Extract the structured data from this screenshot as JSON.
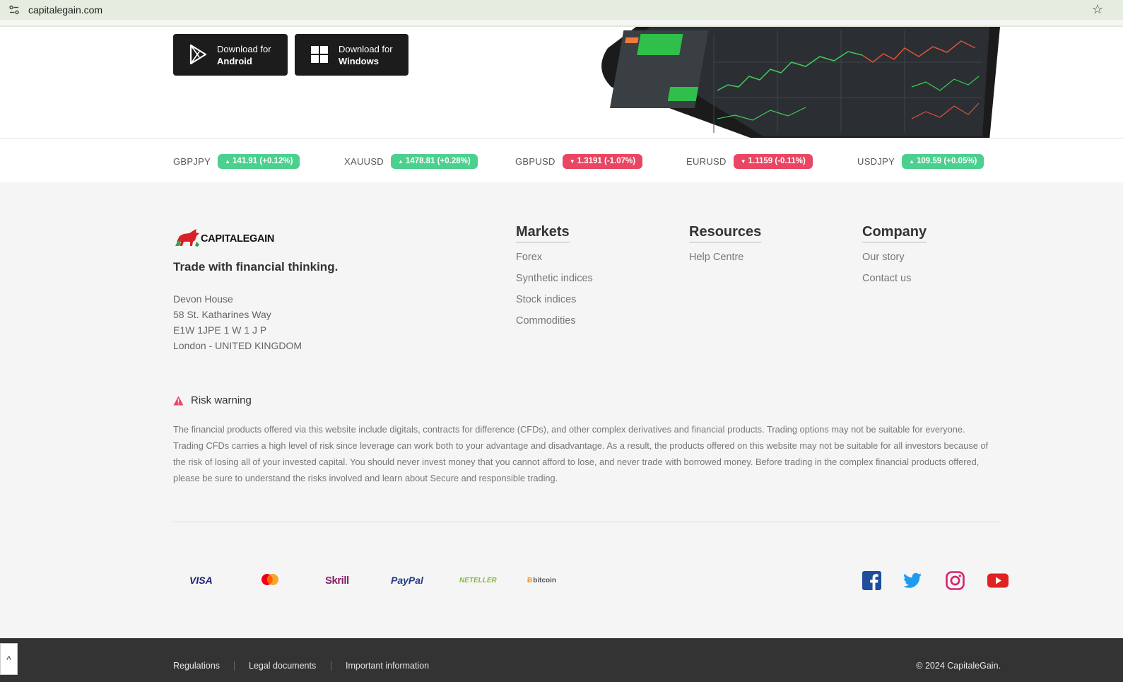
{
  "browser": {
    "url": "capitalegain.com"
  },
  "downloads": [
    {
      "line1": "Download for",
      "line2": "Android"
    },
    {
      "line1": "Download for",
      "line2": "Windows"
    }
  ],
  "ticker": [
    {
      "symbol": "GBPJPY",
      "value": "141.91",
      "change": "(+0.12%)",
      "direction": "up"
    },
    {
      "symbol": "XAUUSD",
      "value": "1478.81",
      "change": "(+0.28%)",
      "direction": "up"
    },
    {
      "symbol": "GBPUSD",
      "value": "1.3191",
      "change": "(-1.07%)",
      "direction": "down"
    },
    {
      "symbol": "EURUSD",
      "value": "1.1159",
      "change": "(-0.11%)",
      "direction": "down"
    },
    {
      "symbol": "USDJPY",
      "value": "109.59",
      "change": "(+0.05%)",
      "direction": "up"
    }
  ],
  "brand": {
    "name": "CAPITALEGAIN",
    "tagline": "Trade with financial thinking.",
    "address": [
      "Devon House",
      "58 St. Katharines Way",
      "E1W 1JPE 1 W 1 J P",
      "London - UNITED KINGDOM"
    ]
  },
  "columns": [
    {
      "title": "Markets",
      "links": [
        "Forex",
        "Synthetic indices",
        "Stock indices",
        "Commodities"
      ]
    },
    {
      "title": "Resources",
      "links": [
        "Help Centre"
      ]
    },
    {
      "title": "Company",
      "links": [
        "Our story",
        "Contact us"
      ]
    }
  ],
  "risk": {
    "title": "Risk warning",
    "text": "The financial products offered via this website include digitals, contracts for difference (CFDs), and other complex derivatives and financial products. Trading options may not be suitable for everyone. Trading CFDs carries a high level of risk since leverage can work both to your advantage and disadvantage. As a result, the products offered on this website may not be suitable for all investors because of the risk of losing all of your invested capital. You should never invest money that you cannot afford to lose, and never trade with borrowed money. Before trading in the complex financial products offered, please be sure to understand the risks involved and learn about Secure and responsible trading."
  },
  "payments": {
    "visa": "VISA",
    "skrill": "Skrill",
    "paypal": "PayPal",
    "neteller": "NETELLER",
    "bitcoin": "bitcoin"
  },
  "bottom": {
    "links": [
      "Regulations",
      "Legal documents",
      "Important information"
    ],
    "copyright": "© 2024 CapitaleGain."
  },
  "colors": {
    "up": "#4bd08e",
    "down": "#ea4563",
    "bottom_bar": "#333333"
  }
}
